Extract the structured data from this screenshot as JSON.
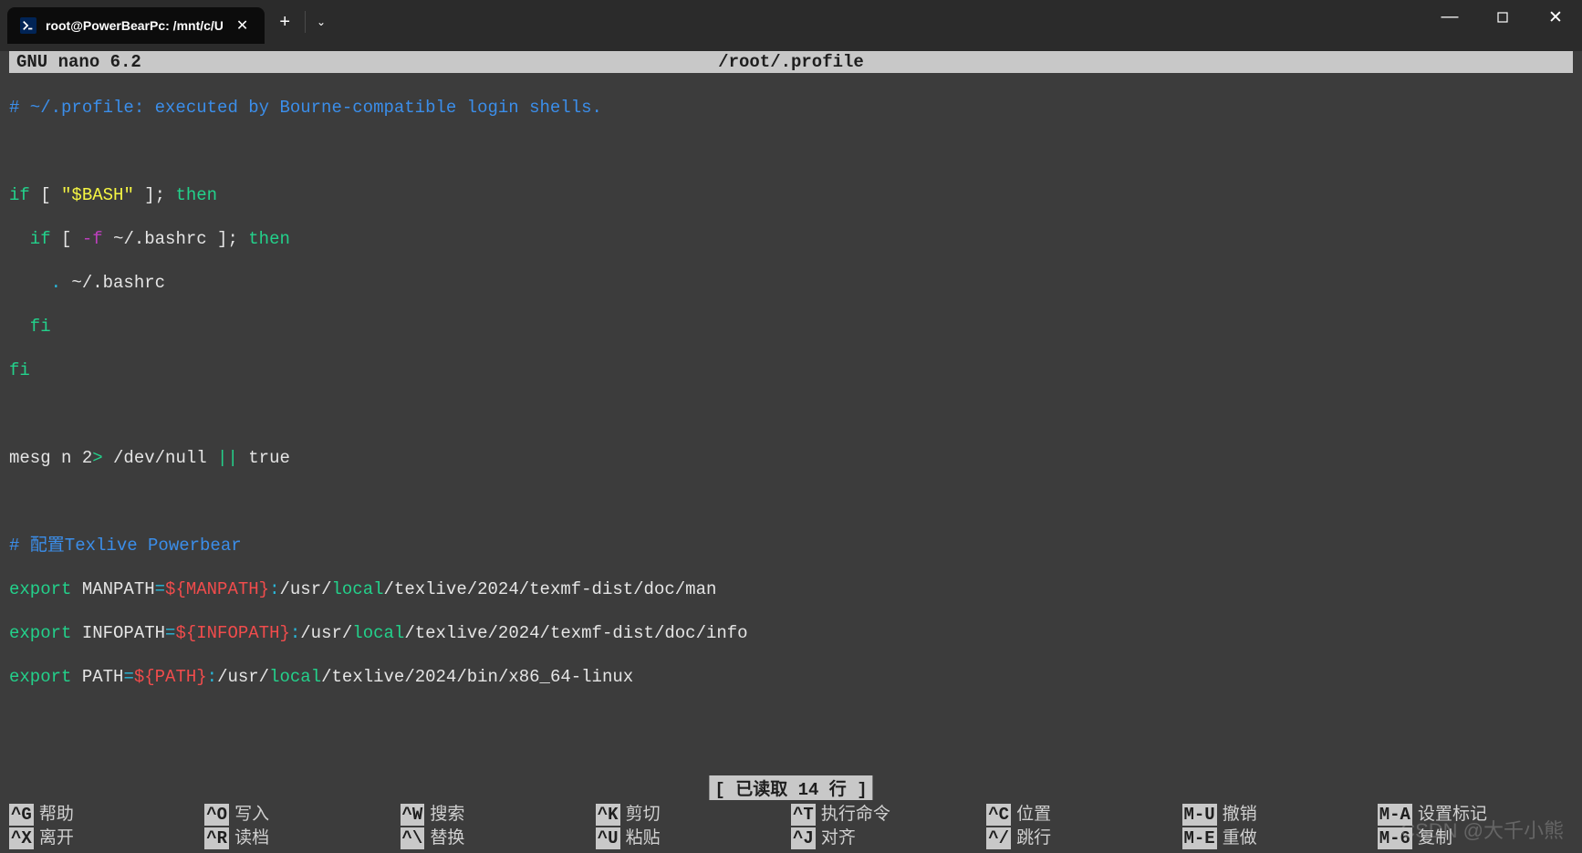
{
  "window": {
    "tab_title": "root@PowerBearPc: /mnt/c/U",
    "new_tab": "+",
    "dropdown": "⌄",
    "minimize": "—",
    "maximize": "▢",
    "close": "✕",
    "tab_close": "✕"
  },
  "nano": {
    "title": "GNU nano 6.2",
    "filename": "/root/.profile",
    "status": "[ 已读取 14 行 ]"
  },
  "code": {
    "l1": {
      "s1": "# ~/.profile: executed by Bourne-compatible login shells."
    },
    "l2": {
      "s1": ""
    },
    "l3": {
      "s1": "if",
      "s2": " [ ",
      "s3": "\"$BASH\"",
      "s4": " ]; ",
      "s5": "then"
    },
    "l4": {
      "s1": "  if",
      "s2": " [ ",
      "s3": "-f",
      "s4": " ~/.bashrc ]; ",
      "s5": "then"
    },
    "l5": {
      "s1": "    ",
      "s2": ".",
      "s3": " ~/.bashrc"
    },
    "l6": {
      "s1": "  fi"
    },
    "l7": {
      "s1": "fi"
    },
    "l8": {
      "s1": ""
    },
    "l9": {
      "s1": "mesg n 2",
      "s2": ">",
      "s3": " /dev/null ",
      "s4": "||",
      "s5": " true"
    },
    "l10": {
      "s1": ""
    },
    "l11": {
      "s1": "# 配置Texlive Powerbear"
    },
    "l12": {
      "s1": "export",
      "s2": " MANPATH",
      "s3": "=",
      "s4": "${MANPATH}",
      "s5": ":",
      "s6": "/usr/",
      "s7": "local",
      "s8": "/texlive/2024/texmf-dist/doc/man"
    },
    "l13": {
      "s1": "export",
      "s2": " INFOPATH",
      "s3": "=",
      "s4": "${INFOPATH}",
      "s5": ":",
      "s6": "/usr/",
      "s7": "local",
      "s8": "/texlive/2024/texmf-dist/doc/info"
    },
    "l14": {
      "s1": "export",
      "s2": " PATH",
      "s3": "=",
      "s4": "${PATH}",
      "s5": ":",
      "s6": "/usr/",
      "s7": "local",
      "s8": "/texlive/2024/bin/x86_64-linux"
    }
  },
  "help": [
    {
      "key": "^G",
      "label": "帮助"
    },
    {
      "key": "^O",
      "label": "写入"
    },
    {
      "key": "^W",
      "label": "搜索"
    },
    {
      "key": "^K",
      "label": "剪切"
    },
    {
      "key": "^T",
      "label": "执行命令"
    },
    {
      "key": "^C",
      "label": "位置"
    },
    {
      "key": "M-U",
      "label": "撤销"
    },
    {
      "key": "M-A",
      "label": "设置标记"
    },
    {
      "key": "^X",
      "label": "离开"
    },
    {
      "key": "^R",
      "label": "读档"
    },
    {
      "key": "^\\",
      "label": "替换"
    },
    {
      "key": "^U",
      "label": "粘贴"
    },
    {
      "key": "^J",
      "label": "对齐"
    },
    {
      "key": "^/",
      "label": "跳行"
    },
    {
      "key": "M-E",
      "label": "重做"
    },
    {
      "key": "M-6",
      "label": "复制"
    }
  ],
  "watermark": "CSDN @大千小熊"
}
